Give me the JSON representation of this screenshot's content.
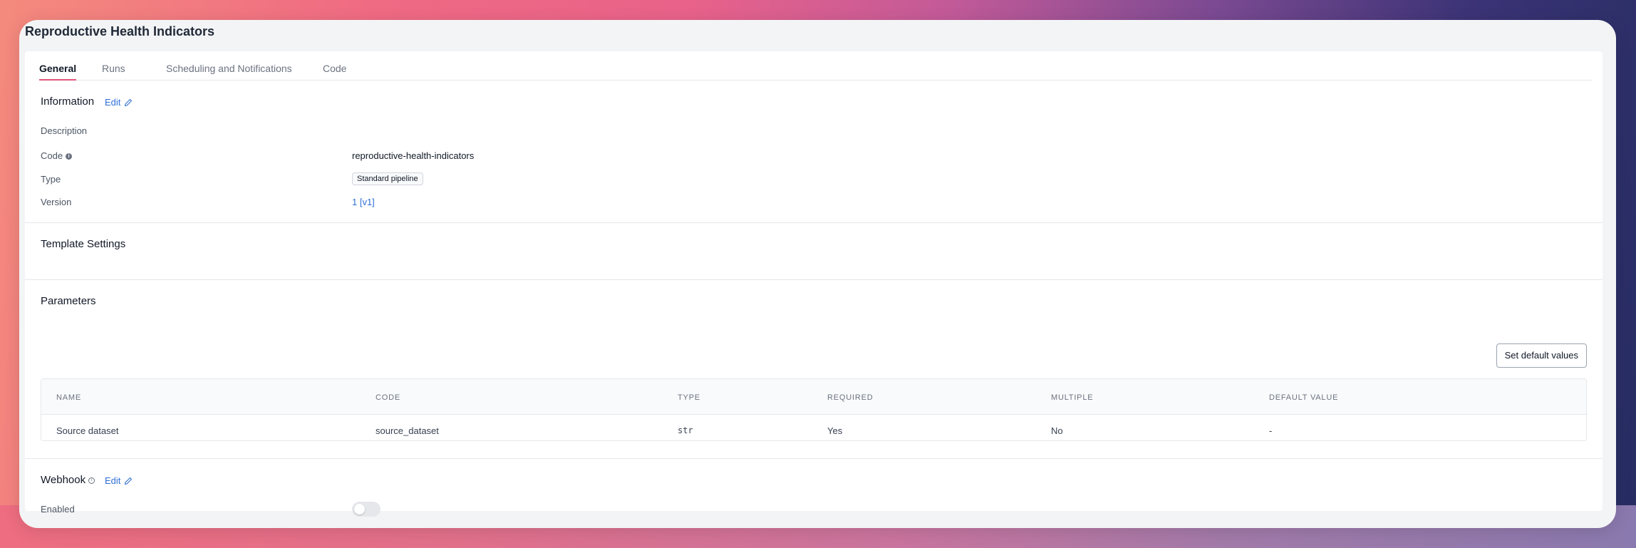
{
  "page": {
    "title": "Reproductive Health Indicators"
  },
  "tabs": [
    {
      "label": "General",
      "active": true
    },
    {
      "label": "Runs",
      "active": false
    },
    {
      "label": "Scheduling and Notifications",
      "active": false
    },
    {
      "label": "Code",
      "active": false
    }
  ],
  "information": {
    "title": "Information",
    "edit_label": "Edit",
    "fields": {
      "description": {
        "label": "Description",
        "value": ""
      },
      "code": {
        "label": "Code",
        "value": "reproductive-health-indicators"
      },
      "type": {
        "label": "Type",
        "value": "Standard pipeline"
      },
      "version": {
        "label": "Version",
        "value": "1 [v1]"
      }
    }
  },
  "template_settings": {
    "title": "Template Settings"
  },
  "parameters": {
    "title": "Parameters",
    "set_default_label": "Set default values",
    "columns": [
      "NAME",
      "CODE",
      "TYPE",
      "REQUIRED",
      "MULTIPLE",
      "DEFAULT VALUE"
    ],
    "rows": [
      {
        "name": "Source dataset",
        "code": "source_dataset",
        "type": "str",
        "required": "Yes",
        "multiple": "No",
        "default": "-"
      }
    ]
  },
  "webhook": {
    "title": "Webhook",
    "edit_label": "Edit",
    "enabled_label": "Enabled",
    "enabled": false
  },
  "colors": {
    "accent": "#e0557a",
    "link": "#2f6fd6"
  }
}
